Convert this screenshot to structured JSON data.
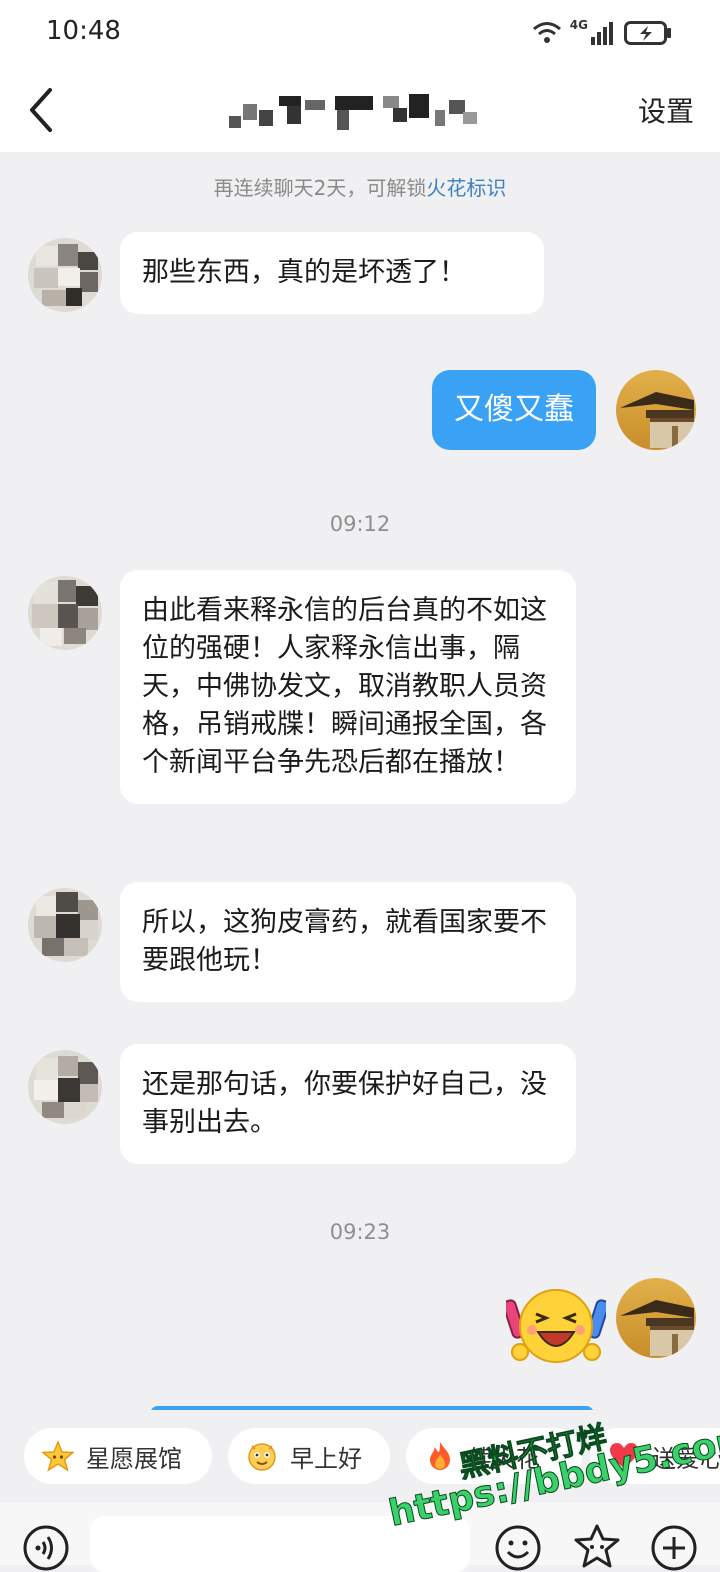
{
  "status_bar": {
    "time": "10:48",
    "network": "4G"
  },
  "header": {
    "back_icon": "chevron-left-icon",
    "settings_label": "设置"
  },
  "chat": {
    "system_note": {
      "text": "再连续聊天2天，可解锁",
      "link": "火花标识"
    },
    "messages": [
      {
        "sender": "other",
        "text": "那些东西，真的是坏透了！"
      },
      {
        "sender": "me",
        "text": "又傻又蠢"
      },
      {
        "type": "time",
        "text": "09:12"
      },
      {
        "sender": "other",
        "text": "由此看来释永信的后台真的不如这位的强硬！人家释永信出事，隔天，中佛协发文，取消教职人员资格，吊销戒牒！瞬间通报全国，各个新闻平台争先恐后都在播放！"
      },
      {
        "sender": "other",
        "text": "所以，这狗皮膏药，就看国家要不要跟他玩！"
      },
      {
        "sender": "other",
        "text": "还是那句话，你要保护好自己，没事别出去。"
      },
      {
        "type": "time",
        "text": "09:23"
      },
      {
        "sender": "me",
        "type": "sticker",
        "icon": "laughing-cheering-sticker-icon"
      }
    ]
  },
  "quick_actions": [
    {
      "label": "星愿展馆",
      "icon": "star-icon"
    },
    {
      "label": "早上好",
      "icon": "smiling-face-icon"
    },
    {
      "label": "续火花",
      "icon": "flame-icon"
    },
    {
      "label": "送爱心",
      "icon": "heart-icon"
    }
  ],
  "input_bar": {
    "voice_icon": "voice-icon",
    "emoji_icon": "emoji-icon",
    "favorite_sticker_icon": "star-sticker-icon",
    "add_icon": "plus-circle-icon"
  },
  "watermark": {
    "line1": "黑料不打烊",
    "line2": "https://bbdy5.com"
  },
  "colors": {
    "my_bubble": "#3aa2f5",
    "link": "#3b82c4",
    "background": "#f0f0f2"
  }
}
